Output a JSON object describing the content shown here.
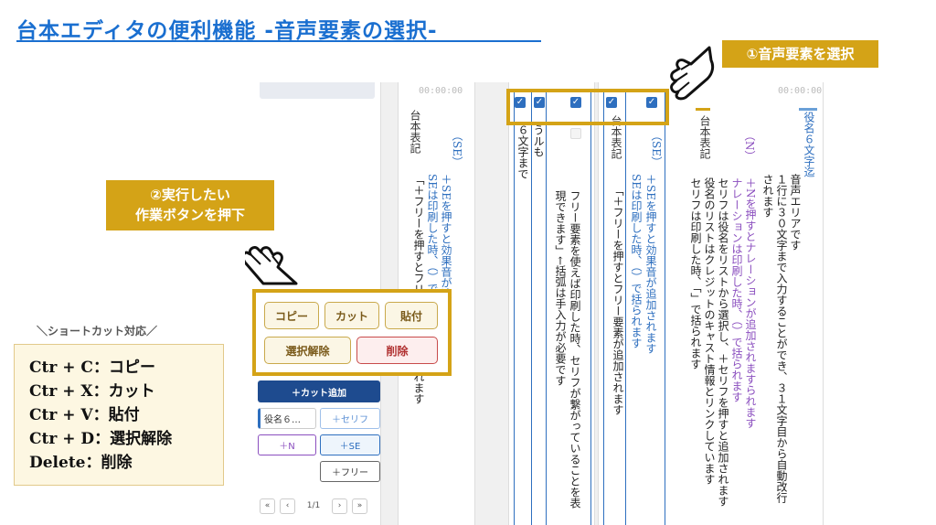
{
  "title": "台本エディタの便利機能 -音声要素の選択-",
  "callouts": {
    "step1": "①音声要素を選択",
    "step2_line1": "②実行したい",
    "step2_line2": "作業ボタンを押下"
  },
  "shortcuts": {
    "heading": "＼ショートカット対応／",
    "items": [
      "Ctr + C：コピー",
      "Ctr + X：カット",
      "Ctr + V：貼付",
      "Ctr + D：選択解除",
      "Delete：削除"
    ]
  },
  "actions": {
    "copy": "コピー",
    "cut": "カット",
    "paste": "貼付",
    "deselect": "選択解除",
    "delete": "削除"
  },
  "sidebar": {
    "add_cut": "＋カット追加",
    "role_chip": "役名６…",
    "add_serif": "＋セリフ",
    "add_n": "＋N",
    "add_se": "＋SE",
    "add_free": "＋フリー",
    "pager": {
      "first": "«",
      "prev": "‹",
      "page": "1/1",
      "next": "›",
      "last": "»"
    }
  },
  "pages": {
    "timecode": "00:00:00",
    "page1": {
      "label": "台本表記",
      "se_tag": "（SE）",
      "se_desc1": "＋SEを押すと効果音が追加されます",
      "se_desc2": "SEは印刷した時、（）で括られます",
      "free_desc": "「＋フリーを押すとフリー要素が追加されます"
    },
    "page2": {
      "limit": "６文字まで",
      "shiru": "うルも",
      "free1": "フリー要素を使えば印刷した時、セリフが繋がっていることを表",
      "free2": "現できます」←括弧は手入力が必要です"
    },
    "page3": {
      "label_a": "台本表記",
      "se_tag": "（SE）",
      "se_desc1": "＋SEを押すと効果音が追加されます",
      "se_desc2": "SEは印刷した時、（）で括られます",
      "free_desc": "「＋フリーを押すとフリー要素が追加されます",
      "serif_print": "セリフは印刷した時、「」で括られます",
      "role_list": "役名のリストはクレジットのキャスト情報とリンクしています",
      "serif_desc": "セリフは役名をリストから選択し、＋セリフを押すと追加されます",
      "narration_print": "ナレーションは印刷した時、（）で括られます",
      "n_desc": "＋Nを押すとナレーションが追加されますられます",
      "n_tag": "（N）",
      "label_b": "台本表記",
      "auto_break": "されます",
      "audio_desc": "１行に３０文字まで入力することができ、３１文字目から自動改行",
      "audio_area": "音声エリアです",
      "role_name": "役名６文字迄"
    }
  },
  "colors": {
    "accent": "#d4a317",
    "title_blue": "#1a6fd0",
    "se_blue": "#2e6fbf",
    "narration_purple": "#8b4fbf",
    "delete_red": "#c84b4b"
  }
}
